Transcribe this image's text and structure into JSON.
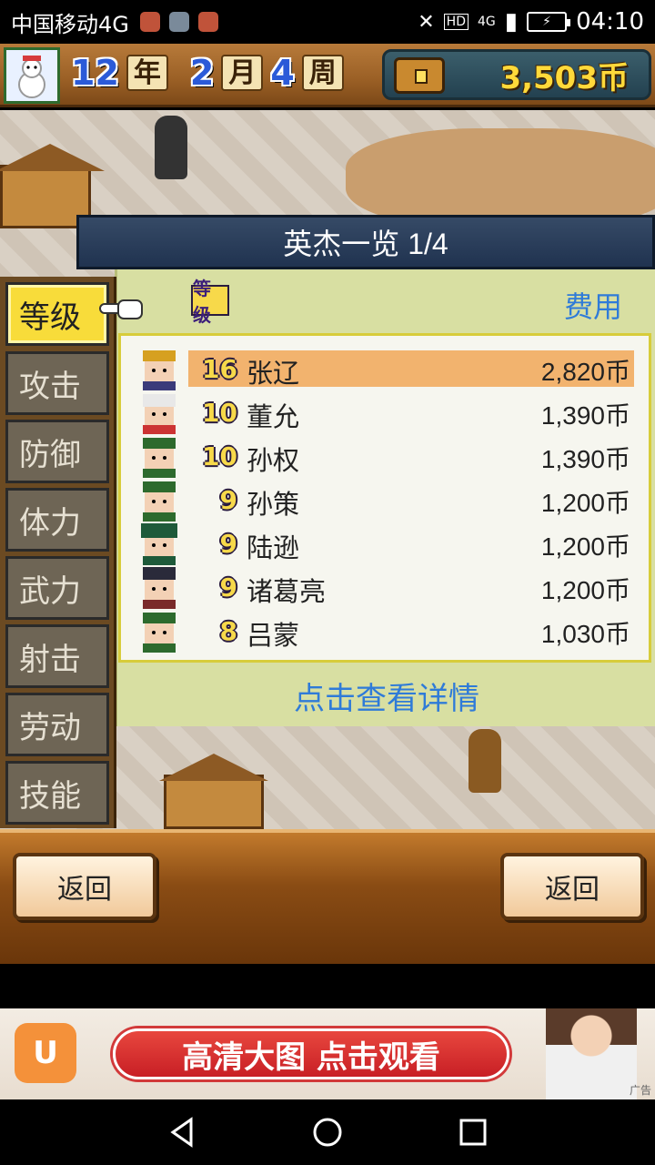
{
  "status_bar": {
    "carrier": "中国移动4G",
    "network": "4G",
    "hd": "HD",
    "time": "04:10"
  },
  "top_bar": {
    "year_num": "12",
    "year_label": "年",
    "month_num": "2",
    "month_label": "月",
    "week_num": "4",
    "week_label": "周",
    "money": "3,503币"
  },
  "panel": {
    "title": "英杰一览 1/4",
    "header_level": "等级",
    "header_cost": "费用",
    "detail_link": "点击查看详情",
    "rows": [
      {
        "level": "16",
        "name": "张辽",
        "cost": "2,820币",
        "selected": true
      },
      {
        "level": "10",
        "name": "董允",
        "cost": "1,390币"
      },
      {
        "level": "10",
        "name": "孙权",
        "cost": "1,390币"
      },
      {
        "level": "9",
        "name": "孙策",
        "cost": "1,200币"
      },
      {
        "level": "9",
        "name": "陆逊",
        "cost": "1,200币"
      },
      {
        "level": "9",
        "name": "诸葛亮",
        "cost": "1,200币"
      },
      {
        "level": "8",
        "name": "吕蒙",
        "cost": "1,030币"
      }
    ]
  },
  "tabs": [
    "等级",
    "攻击",
    "防御",
    "体力",
    "武力",
    "射击",
    "劳动",
    "技能"
  ],
  "buttons": {
    "back_left": "返回",
    "back_right": "返回"
  },
  "ad": {
    "text": "高清大图 点击观看",
    "tag": "广告"
  },
  "colors": {
    "accent_yellow": "#f8dc3a",
    "link_blue": "#2f7bd8",
    "selected_row": "#f2b36e"
  }
}
